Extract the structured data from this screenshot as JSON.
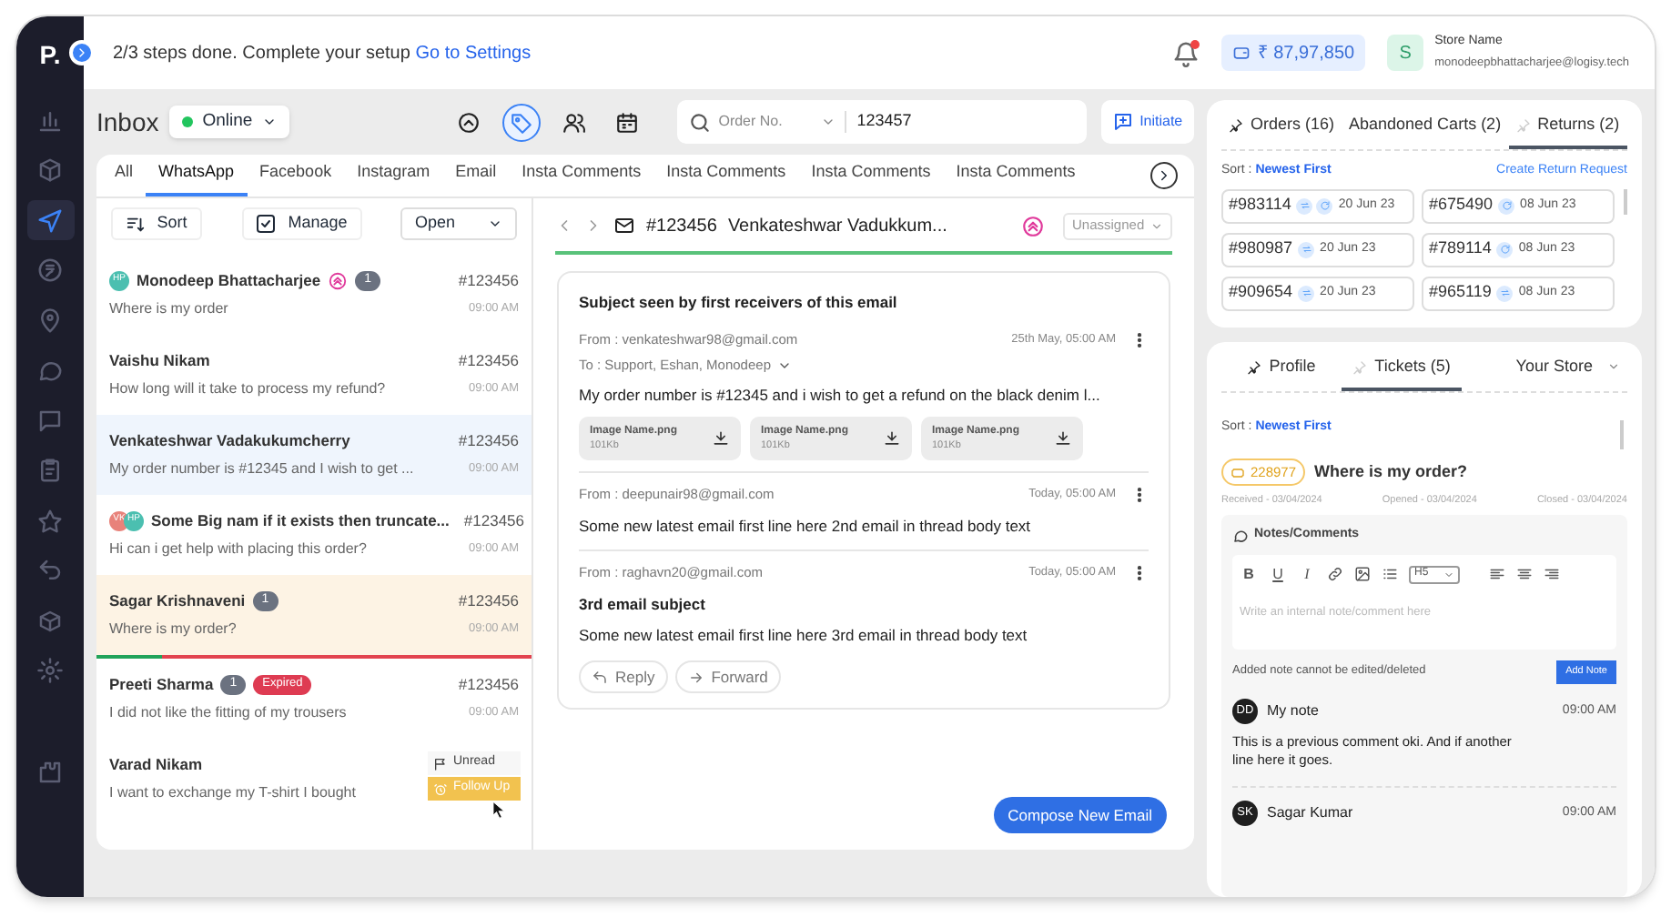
{
  "sidebar": {
    "logo": "P.",
    "items": [
      {
        "selected": false
      },
      {
        "selected": false
      },
      {
        "selected": true
      },
      {
        "selected": false
      },
      {
        "selected": false
      },
      {
        "selected": false
      },
      {
        "selected": false
      },
      {
        "selected": false
      },
      {
        "selected": false
      },
      {
        "selected": false
      },
      {
        "selected": false
      },
      {
        "selected": false
      },
      {
        "selected": false
      }
    ]
  },
  "setup_banner": {
    "text": "2/3 steps done. Complete your setup",
    "link": "Go to Settings"
  },
  "header": {
    "balance": "₹ 87,97,850",
    "store": {
      "avatar": "S",
      "name": "Store Name",
      "email": "monodeepbhattacharjee@logisy.tech"
    }
  },
  "inbox": {
    "title": "Inbox",
    "status": "Online",
    "tools": [
      {
        "selected": false
      },
      {
        "selected": true
      },
      {
        "selected": false
      },
      {
        "selected": false
      }
    ],
    "search": {
      "filter": "Order No.",
      "value": "123457"
    },
    "initiate": "Initiate"
  },
  "channel_tabs": [
    {
      "label": "All",
      "selected": false
    },
    {
      "label": "WhatsApp",
      "selected": true
    },
    {
      "label": "Facebook",
      "selected": false
    },
    {
      "label": "Instagram",
      "selected": false
    },
    {
      "label": "Email",
      "selected": false
    },
    {
      "label": "Insta Comments",
      "selected": false
    },
    {
      "label": "Insta Comments",
      "selected": false
    },
    {
      "label": "Insta Comments",
      "selected": false
    },
    {
      "label": "Insta Comments",
      "selected": false
    }
  ],
  "list_toolbar": {
    "sort": "Sort",
    "manage": "Manage",
    "filter": "Open"
  },
  "conversations": [
    {
      "avatars": [
        {
          "initials": "HP",
          "color": "#4bbfb0"
        }
      ],
      "name": "Monodeep Bhattacharjee",
      "assigned": true,
      "unread": "1",
      "order": "#123456",
      "preview": "Where is my order",
      "time": "09:00 AM",
      "selected": false,
      "flagged": false
    },
    {
      "name": "Vaishu Nikam",
      "assigned": false,
      "order": "#123456",
      "preview": "How long will it take to process my refund?",
      "time": "09:00 AM",
      "selected": false,
      "flagged": false
    },
    {
      "name": "Venkateshwar Vadakukumcherry",
      "assigned": false,
      "order": "#123456",
      "preview": "My order number is #12345 and I wish to get ...",
      "time": "09:00 AM",
      "selected": true,
      "flagged": false
    },
    {
      "avatars": [
        {
          "initials": "VK",
          "color": "#e8827a"
        },
        {
          "initials": "HP",
          "color": "#4bbfb0"
        }
      ],
      "name": "Some Big nam if it exists then truncate...",
      "assigned": false,
      "order": "#123456",
      "preview": "Hi can i get help with placing this order?",
      "time": "09:00 AM",
      "selected": false,
      "flagged": false
    },
    {
      "name": "Sagar Krishnaveni",
      "assigned": false,
      "unread": "1",
      "order": "#123456",
      "preview": "Where is my order?",
      "time": "09:00 AM",
      "selected": false,
      "flagged": true,
      "sla_bar": {
        "level": 0.15
      }
    },
    {
      "name": "Preeti Sharma",
      "assigned": false,
      "unread": "1",
      "expired": "Expired",
      "order": "#123456",
      "preview": "I did not like the fitting of my trousers",
      "time": "09:00 AM",
      "selected": false,
      "flagged": false
    },
    {
      "name": "Varad Nikam",
      "assigned": false,
      "preview": "I want to exchange my T-shirt I bought",
      "selected": false,
      "flagged": false,
      "actions": [
        "Unread",
        "Follow Up"
      ]
    }
  ],
  "thread": {
    "order": "#123456",
    "title": "Venkateshwar Vadukkum...",
    "assignee": "Unassigned",
    "subject": "Subject seen by first receivers of this email",
    "emails": [
      {
        "from": "From : venkateshwar98@gmail.com",
        "to": "To : Support, Eshan, Monodeep",
        "date": "25th May, 05:00 AM",
        "body": "My order number is #12345 and i wish to get a refund on the black denim l...",
        "attachments": [
          {
            "name": "Image Name.png",
            "size": "101Kb"
          },
          {
            "name": "Image Name.png",
            "size": "101Kb"
          },
          {
            "name": "Image Name.png",
            "size": "101Kb"
          }
        ]
      },
      {
        "from": "From : deepunair98@gmail.com",
        "date": "Today, 05:00 AM",
        "body": "Some new latest email first line here 2nd email in thread body text"
      },
      {
        "from": "From : raghavn20@gmail.com",
        "date": "Today, 05:00 AM",
        "subject": "3rd email subject",
        "body": "Some new latest email first line here 3rd email in thread body text",
        "actions": [
          "Reply",
          "Forward"
        ]
      }
    ],
    "compose": "Compose New Email"
  },
  "order_tabs": [
    {
      "label": "Orders (16)",
      "kind": "pinned",
      "selected": false
    },
    {
      "label": "Abandoned Carts (2)",
      "kind": "plain",
      "selected": false
    },
    {
      "label": "Returns (2)",
      "kind": "unpinned",
      "selected": true
    }
  ],
  "returns": {
    "sort_label": "Sort :",
    "sort_value": "Newest First",
    "create": "Create Return Request",
    "items": [
      {
        "id": "#983114",
        "badges": [
          {
            "kind": "exchange"
          },
          {
            "kind": "refresh"
          }
        ],
        "date": "20 Jun 23"
      },
      {
        "id": "#675490",
        "badges": [
          {
            "kind": "refresh"
          }
        ],
        "date": "08 Jun 23"
      },
      {
        "id": "#980987",
        "badges": [
          {
            "kind": "exchange"
          }
        ],
        "date": "20 Jun 23"
      },
      {
        "id": "#789114",
        "badges": [
          {
            "kind": "refresh"
          }
        ],
        "date": "08 Jun 23"
      },
      {
        "id": "#909654",
        "badges": [
          {
            "kind": "exchange"
          }
        ],
        "date": "20 Jun 23"
      },
      {
        "id": "#965119",
        "badges": [
          {
            "kind": "exchange"
          }
        ],
        "date": "08 Jun 23"
      }
    ]
  },
  "profile_tabs": [
    {
      "label": "Profile",
      "kind": "pinned",
      "selected": false
    },
    {
      "label": "Tickets (5)",
      "kind": "unpinned",
      "selected": true
    },
    {
      "label": "Your Store",
      "kind": "dropdown",
      "selected": false
    }
  ],
  "tickets": {
    "sort_label": "Sort :",
    "sort_value": "Newest First",
    "ticket": {
      "id": "228977",
      "title": "Where is my order?",
      "received": "Received - 03/04/2024",
      "opened": "Opened - 03/04/2024",
      "closed": "Closed - 03/04/2024"
    }
  },
  "notes": {
    "title": "Notes/Comments",
    "format": [
      "B",
      "U",
      "I"
    ],
    "heading": "H5",
    "placeholder": "Write an internal note/comment here",
    "hint": "Added note cannot be edited/deleted",
    "add": "Add Note",
    "items": [
      {
        "initials": "DD",
        "author": "My note",
        "time": "09:00 AM",
        "text": "This is a previous comment oki. And if another line here it goes."
      },
      {
        "initials": "SK",
        "author": "Sagar Kumar",
        "time": "09:00 AM"
      }
    ]
  }
}
